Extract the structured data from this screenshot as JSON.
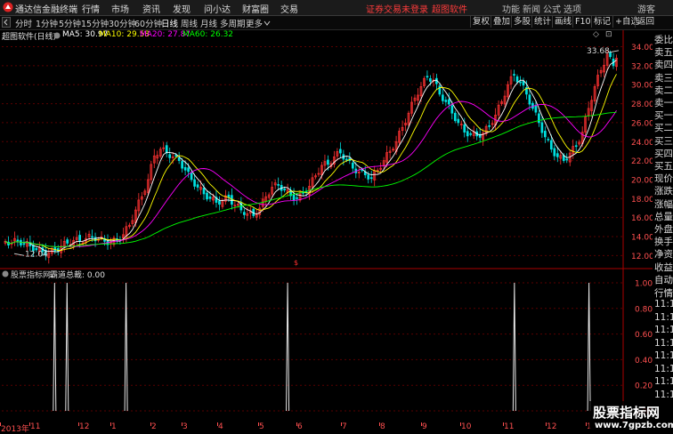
{
  "app": {
    "title": "通达信金融终端"
  },
  "menu": [
    "行情",
    "市场",
    "资讯",
    "发现",
    "问小达",
    "财富圈",
    "交易"
  ],
  "notice": {
    "text": "证券交易未登录",
    "brand": "超图软件"
  },
  "window_buttons": [
    "功能",
    "新闻",
    "公式",
    "选项",
    "游客"
  ],
  "periods": [
    "分时",
    "1分钟",
    "5分钟",
    "15分钟",
    "30分钟",
    "60分钟",
    "日线",
    "周线",
    "月线",
    "多周期",
    "更多"
  ],
  "active_period": "日线",
  "tool_buttons": [
    "复权",
    "叠加",
    "多股",
    "统计",
    "画线",
    "F10",
    "标记",
    "+自选",
    "返回"
  ],
  "chart_header": {
    "stock": "超图软件(日线)",
    "ma5": "MA5: 30.97",
    "ma10": "MA10: 29.58",
    "ma20": "MA20: 27.87",
    "ma60": "MA60: 26.32"
  },
  "price_axis": [
    "34.00",
    "32.00",
    "30.00",
    "28.00",
    "26.00",
    "24.00",
    "22.00",
    "20.00",
    "18.00",
    "16.00",
    "14.00",
    "12.00"
  ],
  "annotations": {
    "high": "33.68",
    "low": "12.04"
  },
  "sub_header": {
    "source": "股票指标网",
    "indicator": "霸道总裁: 0.00"
  },
  "sub_axis": [
    "1.00",
    "0.80",
    "0.60",
    "0.40",
    "0.20",
    "0.00"
  ],
  "date_labels": [
    "2013年",
    "11",
    "12",
    "1",
    "2",
    "3",
    "4",
    "5",
    "6",
    "7",
    "8",
    "9",
    "10",
    "11",
    "12",
    "1"
  ],
  "right_panel": [
    "委比",
    "卖五",
    "卖四",
    "卖三",
    "卖二",
    "卖一",
    "买一",
    "买二",
    "买三",
    "买四",
    "买五",
    "现价",
    "涨跌",
    "涨幅",
    "总量",
    "外盘",
    "换手",
    "净资",
    "收益"
  ],
  "right_panel_lower": [
    "自动",
    "行情",
    "11:1",
    "11:1",
    "11:1",
    "11:1",
    "11:1",
    "11:1",
    "11:1",
    "11:1"
  ],
  "watermark": {
    "line1": "股票指标网",
    "line2": "www.7gpzb.com"
  },
  "colors": {
    "up": "#ff3232",
    "down": "#00e0e0",
    "ma5": "#ffffff",
    "ma10": "#ffff00",
    "ma20": "#ff00ff",
    "ma60": "#00ff00",
    "grid": "#5a0000",
    "axis_text": "#ff5050"
  },
  "chart_data": {
    "type": "candlestick",
    "y_range": [
      11,
      34.8
    ],
    "price_series": [
      13.5,
      13.3,
      13.6,
      13.2,
      13.0,
      12.6,
      12.4,
      12.3,
      12.5,
      13.0,
      13.3,
      13.6,
      13.5,
      13.8,
      14.0,
      13.7,
      13.5,
      13.4,
      13.6,
      14.2,
      15.2,
      16.8,
      18.2,
      20.0,
      22.5,
      23.2,
      22.8,
      22.4,
      22.0,
      21.0,
      20.0,
      19.2,
      18.5,
      18.0,
      17.6,
      17.8,
      18.1,
      17.3,
      16.8,
      16.4,
      16.2,
      17.0,
      18.2,
      19.2,
      19.4,
      18.9,
      18.3,
      18.0,
      18.6,
      19.3,
      20.4,
      21.5,
      21.6,
      22.4,
      22.8,
      22.1,
      21.2,
      20.8,
      20.5,
      20.2,
      21.0,
      22.0,
      23.0,
      24.0,
      25.5,
      27.0,
      28.6,
      29.8,
      30.8,
      30.5,
      29.0,
      28.2,
      27.0,
      26.0,
      25.0,
      24.8,
      24.6,
      24.9,
      25.6,
      26.8,
      28.2,
      30.0,
      31.0,
      30.2,
      29.0,
      27.5,
      26.0,
      24.5,
      23.2,
      22.4,
      22.0,
      22.8,
      23.5,
      25.0,
      27.5,
      29.8,
      31.5,
      33.2,
      32.0
    ],
    "indicator_spikes": [
      0.085,
      0.105,
      0.2,
      0.46,
      0.825,
      0.945
    ],
    "indicator_range": [
      0,
      1
    ],
    "indicator_value": 0.0
  }
}
